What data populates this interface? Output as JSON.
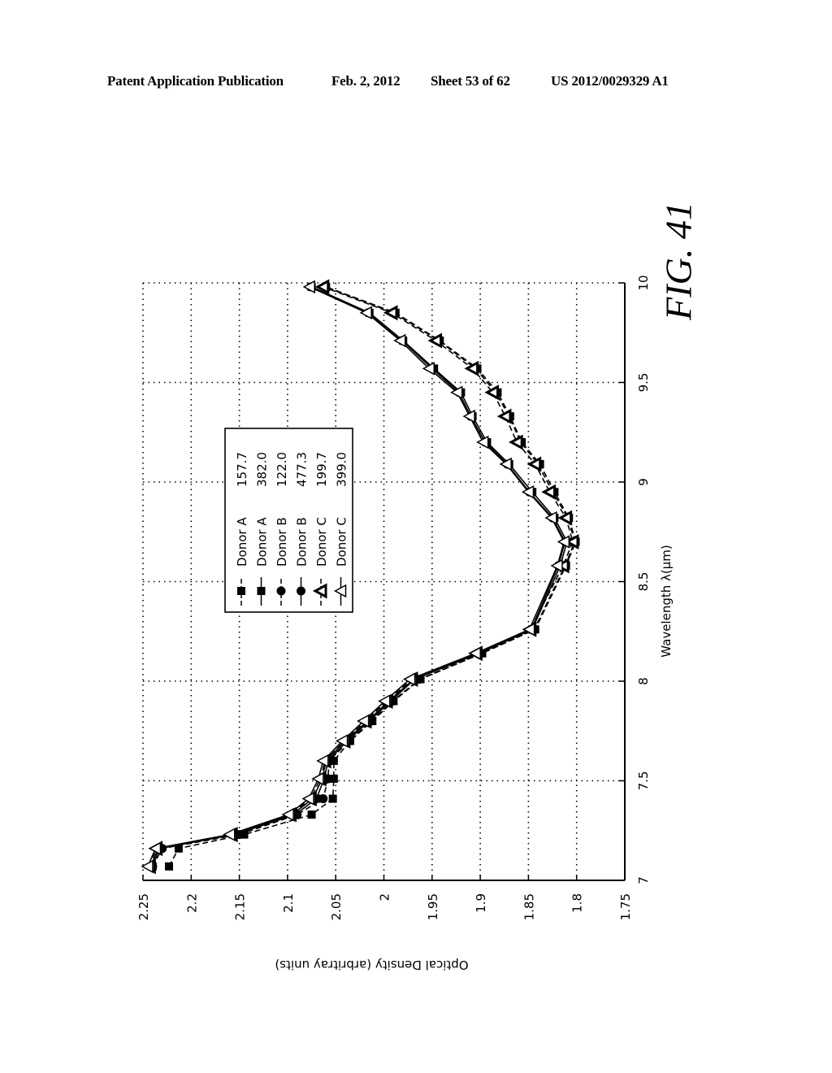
{
  "header": {
    "publication": "Patent Application Publication",
    "date": "Feb. 2, 2012",
    "sheet": "Sheet 53 of 62",
    "number": "US 2012/0029329 A1"
  },
  "figure_label": "FIG. 41",
  "chart_data": {
    "type": "line",
    "orientation": "rotated 90° (x-axis vertical on right, y-axis horizontal along bottom)",
    "title": "",
    "xlabel": "Wavelength λ(μm)",
    "ylabel": "Optical Density (arbritray units)",
    "xlim": [
      7,
      10
    ],
    "ylim": [
      1.75,
      2.25
    ],
    "xticks": [
      "7",
      "7.5",
      "8",
      "8.5",
      "9",
      "9.5",
      "10"
    ],
    "yticks": [
      "2.25",
      "2.2",
      "2.15",
      "2.1",
      "2.05",
      "2",
      "1.95",
      "1.9",
      "1.85",
      "1.8",
      "1.75"
    ],
    "grid": true,
    "legend_position": "center-left",
    "x": [
      7.07,
      7.16,
      7.23,
      7.33,
      7.41,
      7.51,
      7.6,
      7.7,
      7.8,
      7.9,
      8.01,
      8.14,
      8.26,
      8.58,
      8.7,
      8.82,
      8.95,
      9.09,
      9.2,
      9.33,
      9.45,
      9.57,
      9.71,
      9.85,
      9.98
    ],
    "series": [
      {
        "name": "Donor A",
        "value": "157.7",
        "line": "dashed",
        "marker": "square-filled",
        "values": [
          2.223,
          2.213,
          2.145,
          2.075,
          2.053,
          2.052,
          2.052,
          2.035,
          2.012,
          1.99,
          1.962,
          1.898,
          1.843,
          1.811,
          1.801,
          1.808,
          1.823,
          1.838,
          1.857,
          1.869,
          1.882,
          1.903,
          1.942,
          1.988,
          2.06
        ]
      },
      {
        "name": "Donor A",
        "value": "382.0",
        "line": "solid",
        "marker": "square-filled",
        "values": [
          2.24,
          2.233,
          2.155,
          2.092,
          2.07,
          2.062,
          2.058,
          2.038,
          2.015,
          1.993,
          1.968,
          1.901,
          1.846,
          1.817,
          1.81,
          1.823,
          1.846,
          1.87,
          1.893,
          1.908,
          1.92,
          1.948,
          1.98,
          2.015,
          2.075
        ]
      },
      {
        "name": "Donor B",
        "value": "122.0",
        "line": "dashed",
        "marker": "circle-filled",
        "values": [
          2.24,
          2.23,
          2.15,
          2.09,
          2.063,
          2.058,
          2.057,
          2.036,
          2.013,
          1.991,
          1.963,
          1.899,
          1.844,
          1.812,
          1.802,
          1.809,
          1.825,
          1.84,
          1.858,
          1.87,
          1.884,
          1.905,
          1.943,
          1.99,
          2.061
        ]
      },
      {
        "name": "Donor B",
        "value": "477.3",
        "line": "solid",
        "marker": "circle-filled",
        "values": [
          2.242,
          2.234,
          2.157,
          2.095,
          2.074,
          2.064,
          2.06,
          2.04,
          2.017,
          1.995,
          1.969,
          1.902,
          1.847,
          1.819,
          1.812,
          1.825,
          1.849,
          1.872,
          1.895,
          1.91,
          1.922,
          1.95,
          1.981,
          2.016,
          2.076
        ]
      },
      {
        "name": "Donor C",
        "value": "199.7",
        "line": "dashed",
        "marker": "triangle-left-bold",
        "values": [
          2.243,
          2.236,
          2.158,
          2.097,
          2.076,
          2.066,
          2.061,
          2.041,
          2.019,
          1.997,
          1.971,
          1.904,
          1.848,
          1.814,
          1.804,
          1.811,
          1.828,
          1.843,
          1.862,
          1.874,
          1.887,
          1.908,
          1.946,
          1.992,
          2.063
        ]
      },
      {
        "name": "Donor C",
        "value": "399.0",
        "line": "solid",
        "marker": "triangle-left-open",
        "values": [
          2.245,
          2.237,
          2.16,
          2.099,
          2.078,
          2.068,
          2.063,
          2.043,
          2.021,
          1.999,
          1.973,
          1.905,
          1.849,
          1.82,
          1.813,
          1.826,
          1.85,
          1.873,
          1.897,
          1.911,
          1.924,
          1.953,
          1.983,
          2.018,
          2.077
        ]
      }
    ]
  }
}
